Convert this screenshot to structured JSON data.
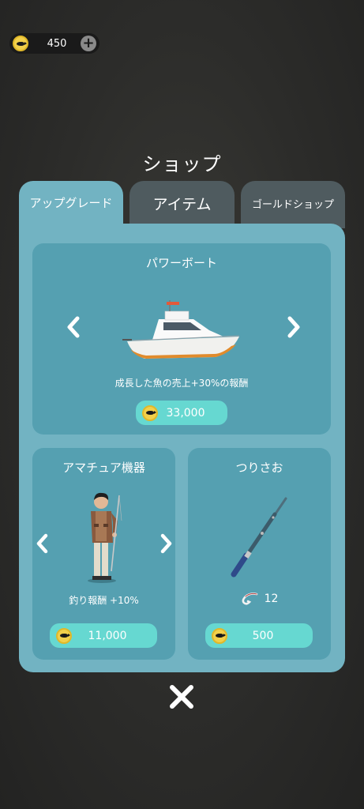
{
  "currency": {
    "amount": "450",
    "icon": "coin-icon",
    "add_icon": "plus-icon"
  },
  "shop": {
    "title": "ショップ",
    "tabs": [
      {
        "label": "アップグレード",
        "active": true
      },
      {
        "label": "アイテム",
        "active": false
      },
      {
        "label": "ゴールドショップ",
        "active": false
      }
    ]
  },
  "boat": {
    "title": "パワーボート",
    "description": "成長した魚の売上+30%の報酬",
    "price": "33,000"
  },
  "equipment": {
    "title": "アマチュア機器",
    "description": "釣り報酬 +10%",
    "price": "11,000"
  },
  "rod": {
    "title": "つりさお",
    "hook_count": "12",
    "price": "500"
  },
  "colors": {
    "panel": "#72b3c2",
    "card": "#55a0b1",
    "price_button": "#66d8d1",
    "coin": "#f2d04b",
    "inactive_tab": "#4f5b5f"
  }
}
